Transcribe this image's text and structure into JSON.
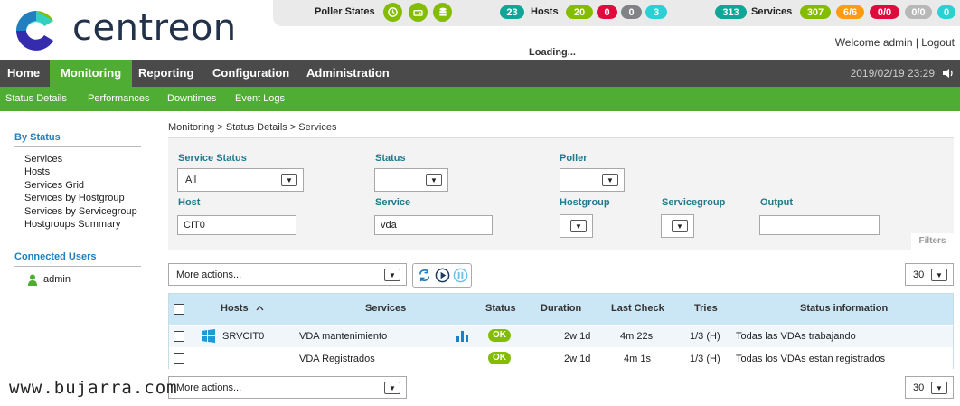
{
  "brand": {
    "name": "centreon"
  },
  "topbar": {
    "poller_label": "Poller States",
    "hosts_label": "Hosts",
    "hosts_total": "23",
    "hosts_counts": [
      "20",
      "0",
      "0",
      "3"
    ],
    "services_label": "Services",
    "services_total": "313",
    "services_counts": [
      "307",
      "6/6",
      "0/0",
      "0/0",
      "0"
    ],
    "loading": "Loading...",
    "welcome": "Welcome admin | Logout"
  },
  "colors": {
    "ok": "#84bd00",
    "warning": "#ff9a13",
    "critical": "#e00b3d",
    "unknown": "#818285",
    "pending": "#2ad1d4",
    "total": "#10a697",
    "menu_green": "#4fad33"
  },
  "nav": {
    "items": [
      "Home",
      "Monitoring",
      "Reporting",
      "Configuration",
      "Administration"
    ],
    "datetime": "2019/02/19 23:29"
  },
  "subnav": {
    "items": [
      "Status Details",
      "Performances",
      "Downtimes",
      "Event Logs"
    ]
  },
  "sidebar": {
    "by_status_title": "By Status",
    "by_status_items": [
      "Services",
      "Hosts",
      "Services Grid",
      "Services by Hostgroup",
      "Services by Servicegroup",
      "Hostgroups Summary"
    ],
    "connected_title": "Connected Users",
    "users": [
      "admin"
    ]
  },
  "breadcrumb": "Monitoring  >  Status Details  >  Services",
  "filters": {
    "service_status_label": "Service Status",
    "service_status_value": "All",
    "status_label": "Status",
    "poller_label": "Poller",
    "host_label": "Host",
    "host_value": "CIT0",
    "service_label": "Service",
    "service_value": "vda",
    "hostgroup_label": "Hostgroup",
    "servicegroup_label": "Servicegroup",
    "output_label": "Output",
    "filters_tab": "Filters"
  },
  "toolbar": {
    "more_actions": "More actions...",
    "page_size": "30"
  },
  "table": {
    "headers": {
      "hosts": "Hosts",
      "services": "Services",
      "status": "Status",
      "duration": "Duration",
      "last_check": "Last Check",
      "tries": "Tries",
      "status_info": "Status information"
    },
    "rows": [
      {
        "host": "SRVCIT0",
        "service": "VDA mantenimiento",
        "status": "OK",
        "duration": "2w 1d",
        "last_check": "4m 22s",
        "tries": "1/3 (H)",
        "info": "Todas las VDAs trabajando"
      },
      {
        "host": "",
        "service": "VDA Registrados",
        "status": "OK",
        "duration": "2w 1d",
        "last_check": "4m 1s",
        "tries": "1/3 (H)",
        "info": "Todas los VDAs estan registrados"
      }
    ]
  },
  "watermark": "www.bujarra.com"
}
